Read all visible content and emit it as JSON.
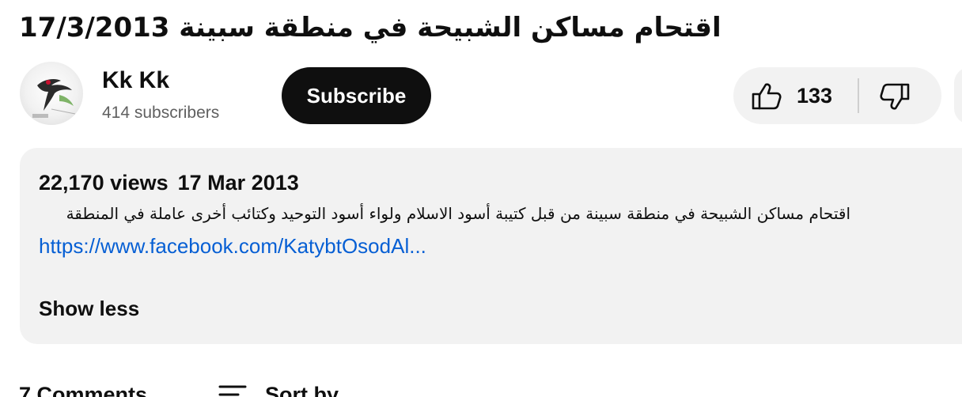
{
  "video": {
    "title": "اقتحام مساكن الشبيحة في منطقة سبينة 17/3/2013"
  },
  "channel": {
    "name": "Kk Kk",
    "subscribers": "414 subscribers",
    "avatar_icon": "channel-avatar-bird-icon"
  },
  "actions": {
    "subscribe_label": "Subscribe",
    "like_count": "133",
    "like_icon": "thumbs-up-icon",
    "dislike_icon": "thumbs-down-icon"
  },
  "description": {
    "views": "22,170 views",
    "date": "17 Mar 2013",
    "text": "اقتحام مساكن الشبيحة في منطقة سبينة من قبل كتيبة أسود الاسلام ولواء أسود التوحيد وكتائب أخرى عاملة في المنطقة",
    "link": "https://www.facebook.com/KatybtOsodAl...",
    "show_less": "Show less"
  },
  "comments": {
    "count_label": "7 Comments",
    "sort_label": "Sort by",
    "sort_icon": "sort-icon"
  },
  "colors": {
    "link": "#065fd4",
    "subscribe_bg": "#0f0f0f",
    "panel_bg": "#f2f2f2",
    "secondary_text": "#606060"
  }
}
